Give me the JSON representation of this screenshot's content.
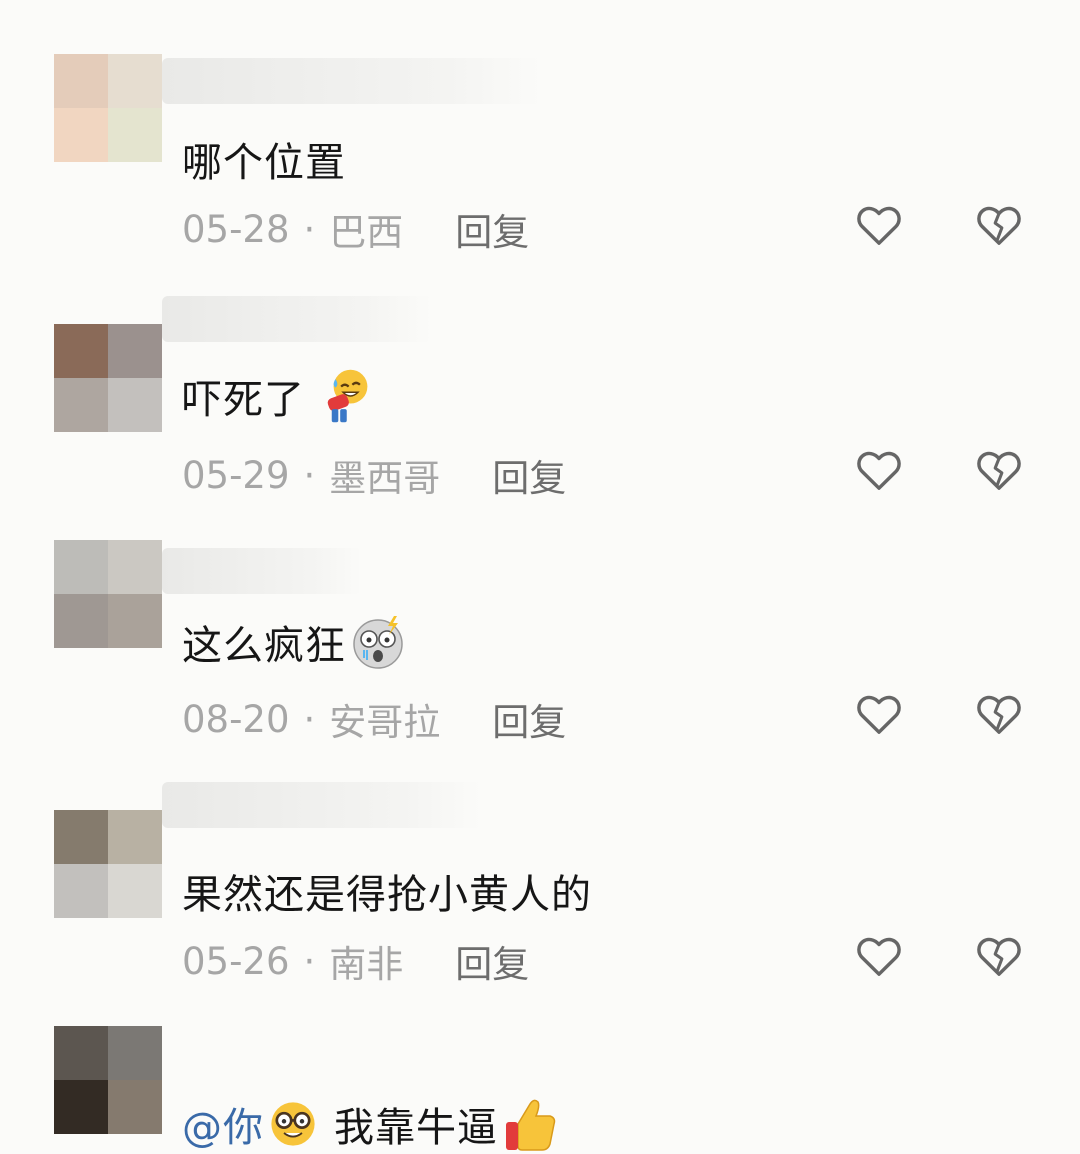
{
  "comments": [
    {
      "text": "哪个位置",
      "date": "05-28",
      "location": "巴西",
      "reply": "回复",
      "emoji": "none"
    },
    {
      "text": "吓死了",
      "date": "05-29",
      "location": "墨西哥",
      "reply": "回复",
      "emoji": "bowing-sweat-face-emoji"
    },
    {
      "text": "这么疯狂",
      "date": "08-20",
      "location": "安哥拉",
      "reply": "回复",
      "emoji": "shocked-face-emoji"
    },
    {
      "text": "果然还是得抢小黄人的",
      "date": "05-26",
      "location": "南非",
      "reply": "回复",
      "emoji": "none"
    },
    {
      "mention": "@你",
      "text": "我靠牛逼",
      "emoji1": "nerd-face-emoji",
      "emoji2": "thumbs-up-emoji"
    }
  ],
  "separator": "·",
  "colors": {
    "background": "#fbfbf9",
    "text": "#161616",
    "meta": "#a6a6a6",
    "reply": "#6d6d6d",
    "icon": "#666666",
    "mention": "#3a6aa8"
  },
  "icons": {
    "like": "heart-outline-icon",
    "dislike": "broken-heart-icon"
  }
}
